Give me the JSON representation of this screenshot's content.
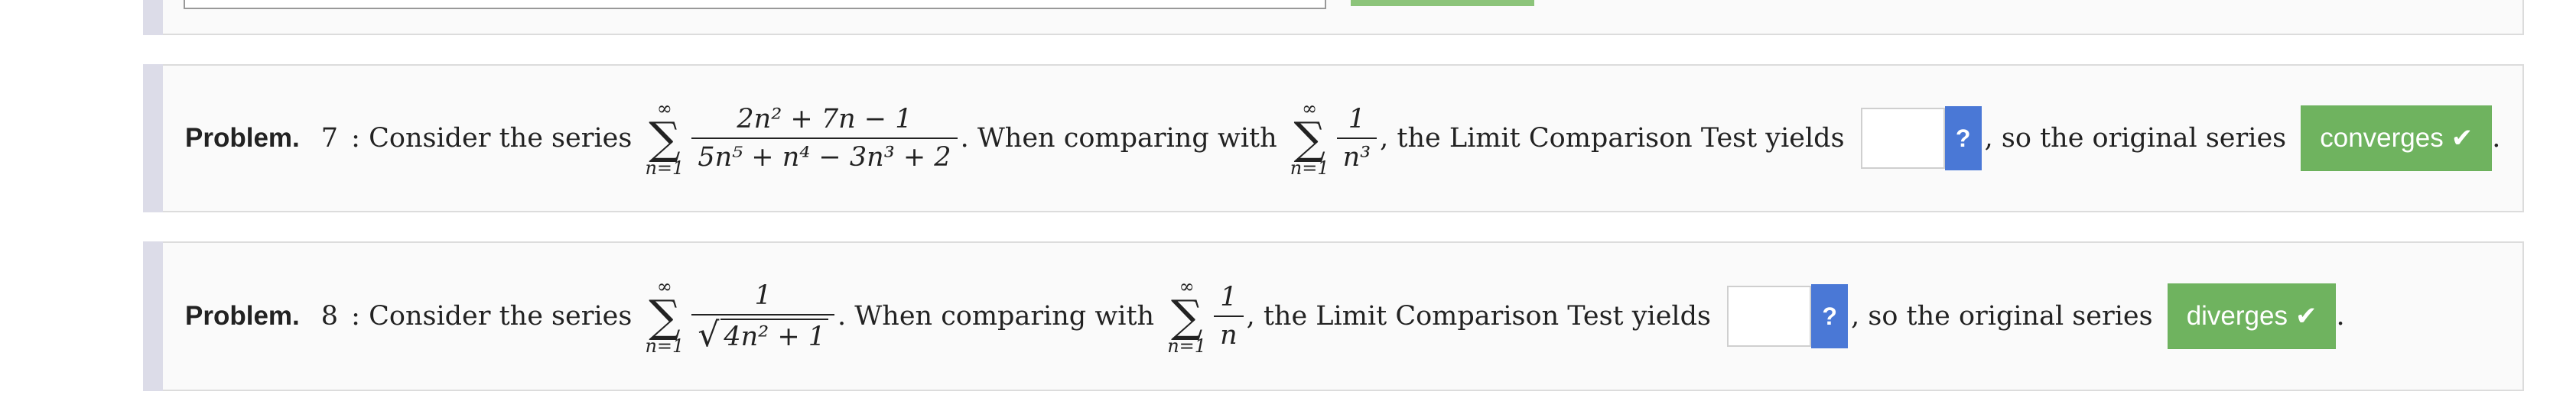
{
  "colors": {
    "button_green": "#6fb35f",
    "help_blue": "#4a78d6",
    "side_bar": "#dcdce8"
  },
  "problems": [
    {
      "label": "Problem.",
      "number": "7",
      "sep": " : ",
      "intro": "Consider the series ",
      "series_lower": "n=1",
      "series_upper": "∞",
      "given_num": "2n² + 7n − 1",
      "given_den": "5n⁵ + n⁴ − 3n³ + 2",
      "mid_text": ". When comparing with ",
      "compare_lower": "n=1",
      "compare_upper": "∞",
      "compare_num": "1",
      "compare_den": "n³",
      "after_text": ", the Limit Comparison Test yields ",
      "answer_value": "",
      "help_label": "?",
      "conclusion_text": ", so the original series ",
      "result_label": "converges",
      "result_icon": "check-icon",
      "end": "."
    },
    {
      "label": "Problem.",
      "number": "8",
      "sep": " : ",
      "intro": "Consider the series ",
      "series_lower": "n=1",
      "series_upper": "∞",
      "given_num": "1",
      "given_den_radicand": "4n² + 1",
      "mid_text": ". When comparing with ",
      "compare_lower": "n=1",
      "compare_upper": "∞",
      "compare_num": "1",
      "compare_den": "n",
      "after_text": ", the Limit Comparison Test yields ",
      "answer_value": "",
      "help_label": "?",
      "conclusion_text": ", so the original series ",
      "result_label": "diverges",
      "result_icon": "check-icon",
      "end": "."
    }
  ]
}
